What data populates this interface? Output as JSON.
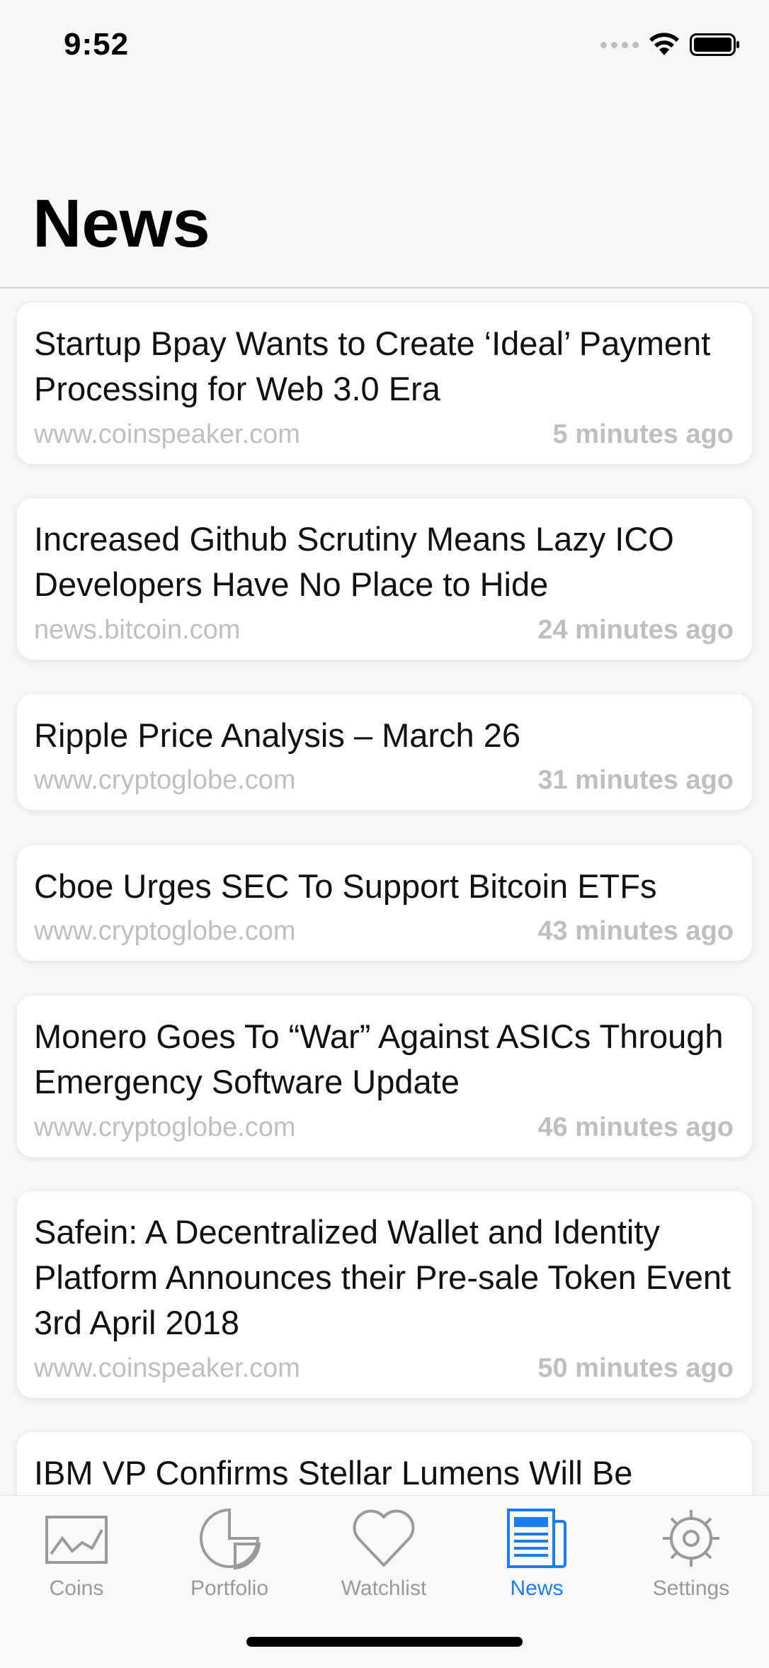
{
  "status": {
    "time": "9:52"
  },
  "page_title": "News",
  "news": [
    {
      "headline": "Startup Bpay Wants to Create ‘Ideal’ Payment Processing for Web 3.0 Era",
      "source": "www.coinspeaker.com",
      "time": "5 minutes ago"
    },
    {
      "headline": "Increased Github Scrutiny Means Lazy ICO Developers Have No Place to Hide",
      "source": "news.bitcoin.com",
      "time": "24 minutes ago"
    },
    {
      "headline": "Ripple Price Analysis – March 26",
      "source": "www.cryptoglobe.com",
      "time": "31 minutes ago"
    },
    {
      "headline": "Cboe Urges SEC To Support Bitcoin ETFs",
      "source": "www.cryptoglobe.com",
      "time": "43 minutes ago"
    },
    {
      "headline": "Monero Goes To “War” Against ASICs Through Emergency Software Update",
      "source": "www.cryptoglobe.com",
      "time": "46 minutes ago"
    },
    {
      "headline": "Safein: A Decentralized Wallet and Identity Platform Announces their Pre-sale Token Event 3rd April 2018",
      "source": "www.coinspeaker.com",
      "time": "50 minutes ago"
    },
    {
      "headline": "IBM VP Confirms Stellar Lumens Will Be",
      "source": "",
      "time": ""
    }
  ],
  "tabs": [
    {
      "label": "Coins",
      "icon": "chart-icon"
    },
    {
      "label": "Portfolio",
      "icon": "pie-chart-icon"
    },
    {
      "label": "Watchlist",
      "icon": "heart-icon"
    },
    {
      "label": "News",
      "icon": "newspaper-icon",
      "active": true
    },
    {
      "label": "Settings",
      "icon": "gear-icon"
    }
  ],
  "colors": {
    "accent": "#1c7cf2",
    "inactive": "#9a9a9a",
    "meta_text": "#bfbfbf"
  }
}
